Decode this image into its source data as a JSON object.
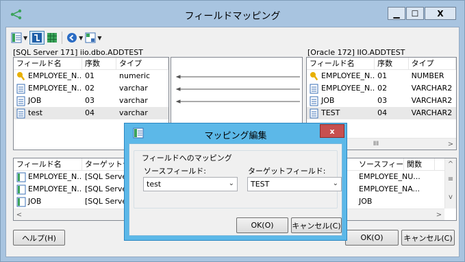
{
  "window": {
    "title": "フィールドマッピング",
    "controls": {
      "minimize": "▁",
      "maximize": "☐",
      "close": "X"
    }
  },
  "toolbar": {
    "icons": [
      "fields-icon",
      "auto-map-icon",
      "grid-icon",
      "back-icon",
      "layout-icon"
    ]
  },
  "source": {
    "label": "[SQL Server 171] iio.dbo.ADDTEST",
    "columns": [
      "フィールド名",
      "序数",
      "タイプ"
    ],
    "rows": [
      {
        "icon": "key",
        "name": "EMPLOYEE_N...",
        "ordinal": "01",
        "type": "numeric"
      },
      {
        "icon": "field",
        "name": "EMPLOYEE_N...",
        "ordinal": "02",
        "type": "varchar"
      },
      {
        "icon": "field",
        "name": "JOB",
        "ordinal": "03",
        "type": "varchar"
      },
      {
        "icon": "field",
        "name": "test",
        "ordinal": "04",
        "type": "varchar"
      }
    ]
  },
  "target": {
    "label": "[Oracle 172] IIO.ADDTEST",
    "columns": [
      "フィールド名",
      "序数",
      "タイプ"
    ],
    "rows": [
      {
        "icon": "key",
        "name": "EMPLOYEE_N...",
        "ordinal": "01",
        "type": "NUMBER"
      },
      {
        "icon": "field",
        "name": "EMPLOYEE_N...",
        "ordinal": "02",
        "type": "VARCHAR2"
      },
      {
        "icon": "field",
        "name": "JOB",
        "ordinal": "03",
        "type": "VARCHAR2"
      },
      {
        "icon": "field",
        "name": "TEST",
        "ordinal": "04",
        "type": "VARCHAR2"
      }
    ],
    "scroll_thumb": "III"
  },
  "mapping_list": {
    "left_columns": [
      "フィールド名",
      "ターゲットテ"
    ],
    "left_rows": [
      {
        "name": "EMPLOYEE_N...",
        "target": "[SQL Serve"
      },
      {
        "name": "EMPLOYEE_N...",
        "target": "[SQL Serve"
      },
      {
        "name": "JOB",
        "target": "[SQL Serve"
      }
    ],
    "right_columns": [
      "ソースフィールド",
      "関数"
    ],
    "right_rows": [
      {
        "source": "EMPLOYEE_NU..."
      },
      {
        "source": "EMPLOYEE_NA..."
      },
      {
        "source": "JOB"
      }
    ]
  },
  "footer": {
    "help": "ヘルプ(H)",
    "ok": "OK(O)",
    "cancel": "キャンセル(C)"
  },
  "dialog": {
    "title": "マッピング編集",
    "close": "x",
    "group_label": "フィールドへのマッピング",
    "source_label": "ソースフィールド:",
    "source_value": "test",
    "target_label": "ターゲットフィールド:",
    "target_value": "TEST",
    "ok": "OK(O)",
    "cancel": "キャンセル(C)"
  },
  "colors": {
    "frame": "#a8c4e0",
    "dialog_frame": "#5cb8e8",
    "dialog_close": "#c75050",
    "key_icon": "#e8b000",
    "field_icon": "#3a6fb5"
  }
}
